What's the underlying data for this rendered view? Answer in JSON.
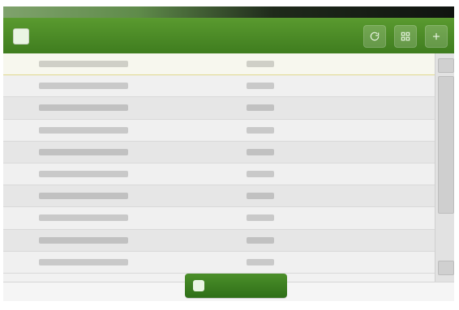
{
  "header": {
    "title": "",
    "actions": [
      {
        "name": "refresh",
        "icon": "refresh-icon"
      },
      {
        "name": "grid",
        "icon": "grid-icon"
      },
      {
        "name": "add",
        "icon": "plus-icon"
      }
    ]
  },
  "rows": [
    {
      "left": "",
      "right": ""
    },
    {
      "left": "",
      "right": ""
    },
    {
      "left": "",
      "right": ""
    },
    {
      "left": "",
      "right": ""
    },
    {
      "left": "",
      "right": ""
    },
    {
      "left": "",
      "right": ""
    },
    {
      "left": "",
      "right": ""
    },
    {
      "left": "",
      "right": ""
    },
    {
      "left": "",
      "right": ""
    },
    {
      "left": "",
      "right": ""
    }
  ],
  "cta": {
    "label": ""
  },
  "colors": {
    "header_green": "#3f7d1f",
    "accent_green": "#2f6f18",
    "row_bg": "#e6e6e6"
  }
}
